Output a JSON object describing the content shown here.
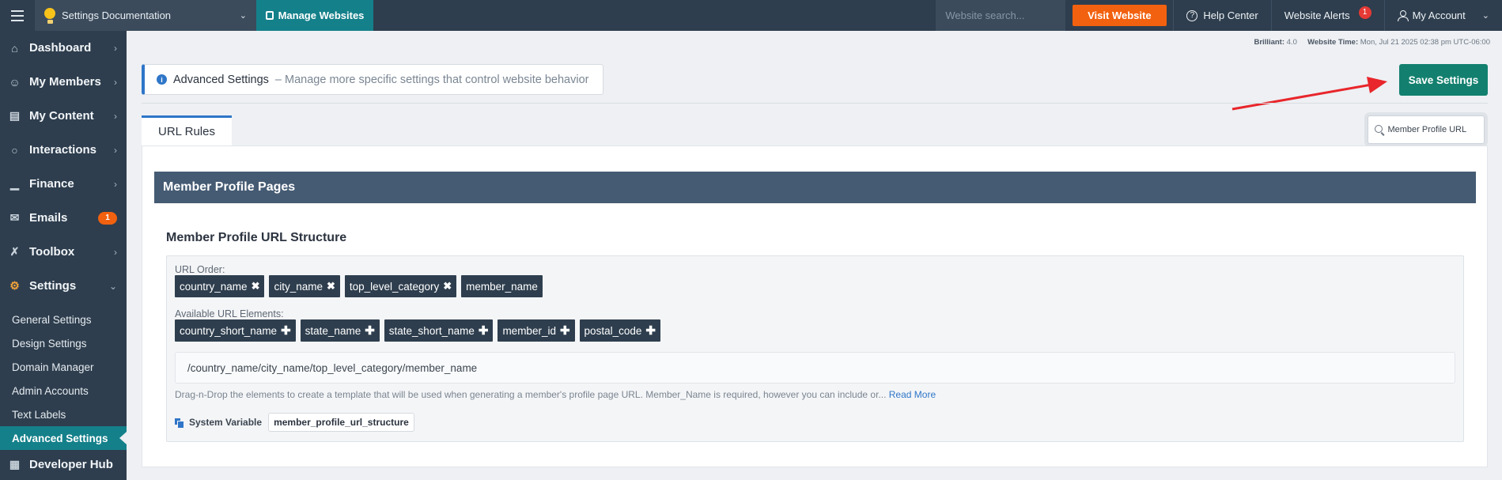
{
  "topbar": {
    "site_name": "Settings Documentation",
    "manage_label": "Manage Websites",
    "search_placeholder": "Website search...",
    "visit_label": "Visit Website",
    "help_label": "Help Center",
    "alerts_label": "Website Alerts",
    "alerts_count": "1",
    "account_label": "My Account"
  },
  "sidebar": {
    "items": [
      {
        "label": "Dashboard",
        "icon": "home-icon"
      },
      {
        "label": "My Members",
        "icon": "user-circle-icon"
      },
      {
        "label": "My Content",
        "icon": "folder-icon"
      },
      {
        "label": "Interactions",
        "icon": "chat-icon"
      },
      {
        "label": "Finance",
        "icon": "bar-chart-icon"
      },
      {
        "label": "Emails",
        "icon": "mail-icon",
        "badge": "1"
      },
      {
        "label": "Toolbox",
        "icon": "tools-icon"
      },
      {
        "label": "Settings",
        "icon": "gear-icon"
      }
    ],
    "sub_items": [
      "General Settings",
      "Design Settings",
      "Domain Manager",
      "Admin Accounts",
      "Text Labels",
      "Advanced Settings"
    ],
    "developer_hub": "Developer Hub"
  },
  "meta": {
    "version_label": "Brilliant:",
    "version": "4.0",
    "time_label": "Website Time:",
    "time": "Mon, Jul 21 2025 02:38 pm UTC-06:00"
  },
  "header": {
    "title": "Advanced Settings",
    "description": "– Manage more specific settings that control website behavior",
    "save_label": "Save Settings"
  },
  "tabs": [
    {
      "label": "URL Rules"
    }
  ],
  "tab_search": {
    "value": "Member Profile URL"
  },
  "section": {
    "title": "Member Profile Pages",
    "field_title": "Member Profile URL Structure",
    "url_order_label": "URL Order:",
    "url_order": [
      "country_name",
      "city_name",
      "top_level_category",
      "member_name"
    ],
    "available_label": "Available URL Elements:",
    "available": [
      "country_short_name",
      "state_name",
      "state_short_name",
      "member_id",
      "postal_code"
    ],
    "preview": "/country_name/city_name/top_level_category/member_name",
    "help_text": "Drag-n-Drop the elements to create a template that will be used when generating a member's profile page URL. Member_Name is required, however you can include or...",
    "read_more": "Read More",
    "sysvar_label": "System Variable",
    "sysvar_value": "member_profile_url_structure"
  },
  "colors": {
    "topbar": "#2e3e4e",
    "teal": "#14808a",
    "save_green": "#13806f",
    "orange": "#f2610f",
    "section_bar": "#455b73",
    "link_blue": "#2f76c8",
    "annotation_red": "#e8262b"
  }
}
